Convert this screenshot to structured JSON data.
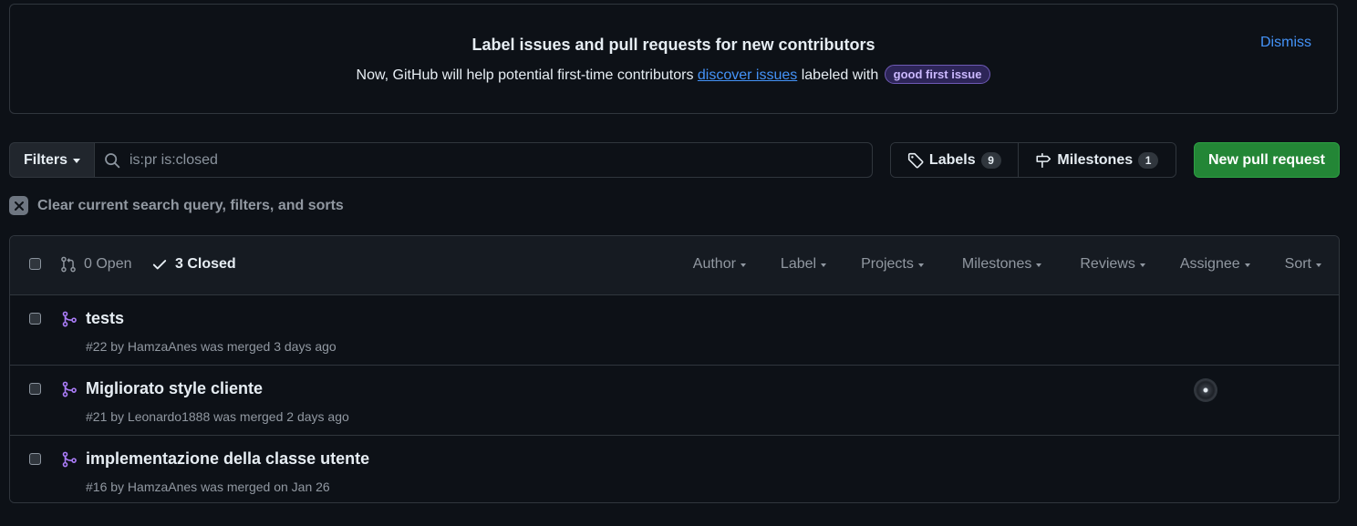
{
  "banner": {
    "title": "Label issues and pull requests for new contributors",
    "text_before": "Now, GitHub will help potential first-time contributors",
    "link_text": "discover issues",
    "text_after": "labeled with",
    "label_name": "good first issue",
    "dismiss": "Dismiss"
  },
  "toolbar": {
    "filters_label": "Filters",
    "search_value": "is:pr is:closed",
    "labels_label": "Labels",
    "labels_count": "9",
    "milestones_label": "Milestones",
    "milestones_count": "1",
    "new_pr_label": "New pull request"
  },
  "clear_text": "Clear current search query, filters, and sorts",
  "list_header": {
    "open": "0 Open",
    "closed": "3 Closed",
    "filters": [
      "Author",
      "Label",
      "Projects",
      "Milestones",
      "Reviews",
      "Assignee",
      "Sort"
    ]
  },
  "pull_requests": [
    {
      "title": "tests",
      "meta": "#22 by HamzaAnes was merged 3 days ago"
    },
    {
      "title": "Migliorato style cliente",
      "meta": "#21 by Leonardo1888 was merged 2 days ago"
    },
    {
      "title": "implementazione della classe utente",
      "meta": "#16 by HamzaAnes was merged on Jan 26"
    }
  ],
  "colors": {
    "accent_link": "#4493f8",
    "merged_purple": "#ab7df8",
    "primary_button": "#238636"
  }
}
